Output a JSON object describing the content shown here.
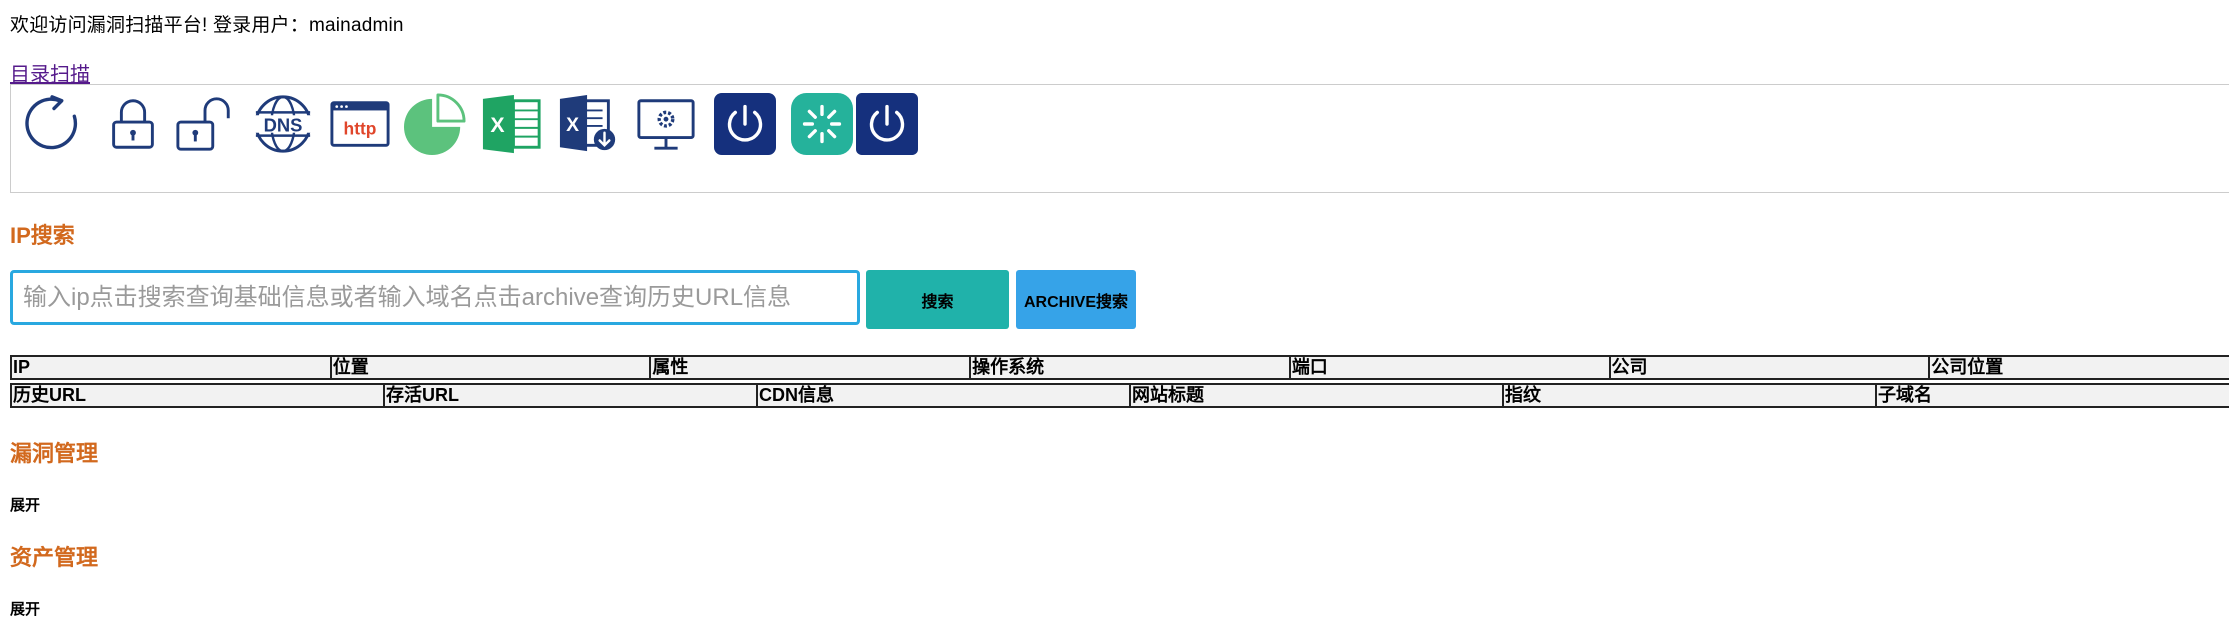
{
  "header": {
    "welcome": "欢迎访问漏洞扫描平台!   登录用户：mainadmin",
    "dir_scan_link": "目录扫描"
  },
  "toolbar": {
    "icons": [
      {
        "name": "refresh-icon",
        "color": "#1f3b7a"
      },
      {
        "name": "lock-icon",
        "color": "#1f3b7a"
      },
      {
        "name": "unlock-icon",
        "color": "#1f3b7a"
      },
      {
        "name": "dns-icon",
        "color": "#1f3b7a"
      },
      {
        "name": "http-icon",
        "color": "#e0462b"
      },
      {
        "name": "pie-chart-icon",
        "color": "#5cc27d"
      },
      {
        "name": "excel-icon",
        "color": "#1fa463"
      },
      {
        "name": "excel-export-icon",
        "color": "#1f3b7a"
      },
      {
        "name": "monitor-settings-icon",
        "color": "#1f3b7a"
      },
      {
        "name": "power-icon",
        "color": "#15307d"
      },
      {
        "name": "loading-icon",
        "color": "#25b29b"
      },
      {
        "name": "power-icon",
        "color": "#15307d"
      }
    ]
  },
  "ip_search": {
    "title": "IP搜索",
    "placeholder": "输入ip点击搜索查询基础信息或者输入域名点击archive查询历史URL信息",
    "search_button": "搜索",
    "archive_button": "ARCHIVE搜索"
  },
  "table1": {
    "headers": [
      "IP",
      "位置",
      "属性",
      "操作系统",
      "端口",
      "公司",
      "公司位置"
    ]
  },
  "table2": {
    "headers": [
      "历史URL",
      "存活URL",
      "CDN信息",
      "网站标题",
      "指纹",
      "子域名"
    ]
  },
  "vuln": {
    "title": "漏洞管理",
    "expand": "展开"
  },
  "asset": {
    "title": "资产管理",
    "expand": "展开"
  },
  "colors": {
    "section_title": "#d2691e",
    "search_button": "#20b2aa",
    "archive_button": "#36a3e8",
    "input_border": "#29a8e0"
  }
}
